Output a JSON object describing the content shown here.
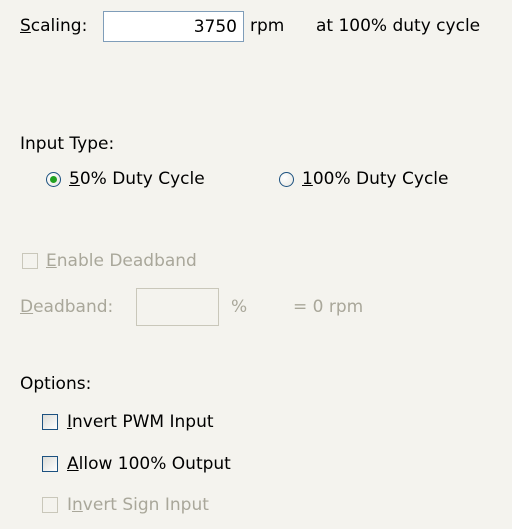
{
  "scaling": {
    "label": "Scaling:",
    "label_mnemonic": "S",
    "label_rest": "caling:",
    "value": "3750",
    "unit": "rpm",
    "note": "at 100% duty cycle"
  },
  "input_type": {
    "heading": "Input Type:",
    "options": [
      {
        "mnemonic": "5",
        "rest": "0% Duty Cycle",
        "selected": true
      },
      {
        "mnemonic": "1",
        "rest": "00% Duty Cycle",
        "selected": false
      }
    ]
  },
  "deadband": {
    "enable_mnemonic": "E",
    "enable_rest": "nable Deadband",
    "field_mnemonic": "D",
    "field_rest": "eadband:",
    "value": "",
    "unit": "%",
    "equivalent": "= 0 rpm",
    "enabled": false
  },
  "options": {
    "heading": "Options:",
    "items": [
      {
        "mnemonic": "I",
        "rest": "nvert PWM Input",
        "checked": false,
        "enabled": true
      },
      {
        "mnemonic": "A",
        "rest": "llow 100% Output",
        "checked": false,
        "enabled": true
      },
      {
        "pre": "I",
        "mnemonic": "n",
        "rest": "vert Sign Input",
        "checked": false,
        "enabled": false
      }
    ]
  }
}
